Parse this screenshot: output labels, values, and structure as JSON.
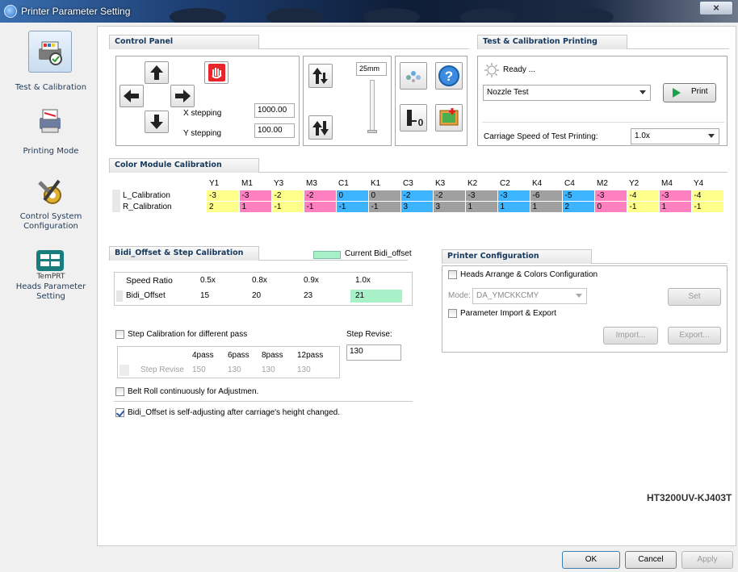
{
  "window": {
    "title": "Printer Parameter Setting",
    "close_glyph": "×"
  },
  "sidebar": {
    "items": [
      {
        "label": "Test & Calibration",
        "icon": "printer-check-icon"
      },
      {
        "label": "Printing Mode",
        "icon": "print-mode-icon"
      },
      {
        "label": "Control System Configuration",
        "icon": "tools-gear-icon"
      },
      {
        "label": "Heads Parameter Setting",
        "icon": "printhead-icon",
        "logo_text": "TemPRT"
      }
    ]
  },
  "control_panel": {
    "title": "Control Panel",
    "x_stepping_label": "X stepping",
    "x_stepping_value": "1000.00",
    "y_stepping_label": "Y stepping",
    "y_stepping_value": "100.00",
    "distance_value": "25mm"
  },
  "test_printing": {
    "title": "Test & Calibration Printing",
    "status": "Ready ...",
    "pattern_selected": "Nozzle Test",
    "print_label": "Print",
    "speed_label": "Carriage Speed of Test Printing:",
    "speed_selected": "1.0x"
  },
  "color_module": {
    "title": "Color Module Calibration",
    "columns": [
      "Y1",
      "M1",
      "Y3",
      "M3",
      "C1",
      "K1",
      "C3",
      "K3",
      "K2",
      "C2",
      "K4",
      "C4",
      "M2",
      "Y2",
      "M4",
      "Y4"
    ],
    "colors": {
      "Y": "#ffff8c",
      "M": "#ff80c0",
      "C": "#3cb4ff",
      "K": "#a0a0a0"
    },
    "rows": [
      {
        "label": "L_Calibration",
        "values": [
          "-3",
          "-3",
          "-2",
          "-2",
          "0",
          "0",
          "-2",
          "-2",
          "-3",
          "-3",
          "-6",
          "-5",
          "-3",
          "-4",
          "-3",
          "-4"
        ]
      },
      {
        "label": "R_Calibration",
        "values": [
          "2",
          "1",
          "-1",
          "-1",
          "-1",
          "-1",
          "3",
          "3",
          "1",
          "1",
          "1",
          "2",
          "0",
          "-1",
          "1",
          "-1"
        ]
      }
    ]
  },
  "bidi": {
    "title": "Bidi_Offset & Step Calibration",
    "legend_label": "Current Bidi_offset",
    "legend_color": "#a8f0c8",
    "speed_header": "Speed Ratio",
    "speeds": [
      "0.5x",
      "0.8x",
      "0.9x",
      "1.0x"
    ],
    "offset_label": "Bidi_Offset",
    "offsets": [
      "15",
      "20",
      "23",
      "21"
    ],
    "step_check_label": "Step Calibration for different pass",
    "passes": [
      "4pass",
      "6pass",
      "8pass",
      "12pass"
    ],
    "step_revise_row_label": "Step Revise",
    "step_revise_values": [
      "150",
      "130",
      "130",
      "130"
    ],
    "step_revise_label": "Step Revise:",
    "step_revise_value": "130",
    "belt_label": "Belt Roll continuously for Adjustmen.",
    "self_adjust_label": "Bidi_Offset is self-adjusting after carriage's height changed."
  },
  "printer_config": {
    "title": "Printer Configuration",
    "heads_label": "Heads Arrange & Colors Configuration",
    "mode_label": "Mode:",
    "mode_value": "DA_YMCKKCMY",
    "set_label": "Set",
    "param_label": "Parameter Import & Export",
    "import_label": "Import...",
    "export_label": "Export..."
  },
  "model_name": "HT3200UV-KJ403T",
  "footer": {
    "ok": "OK",
    "cancel": "Cancel",
    "apply": "Apply"
  }
}
